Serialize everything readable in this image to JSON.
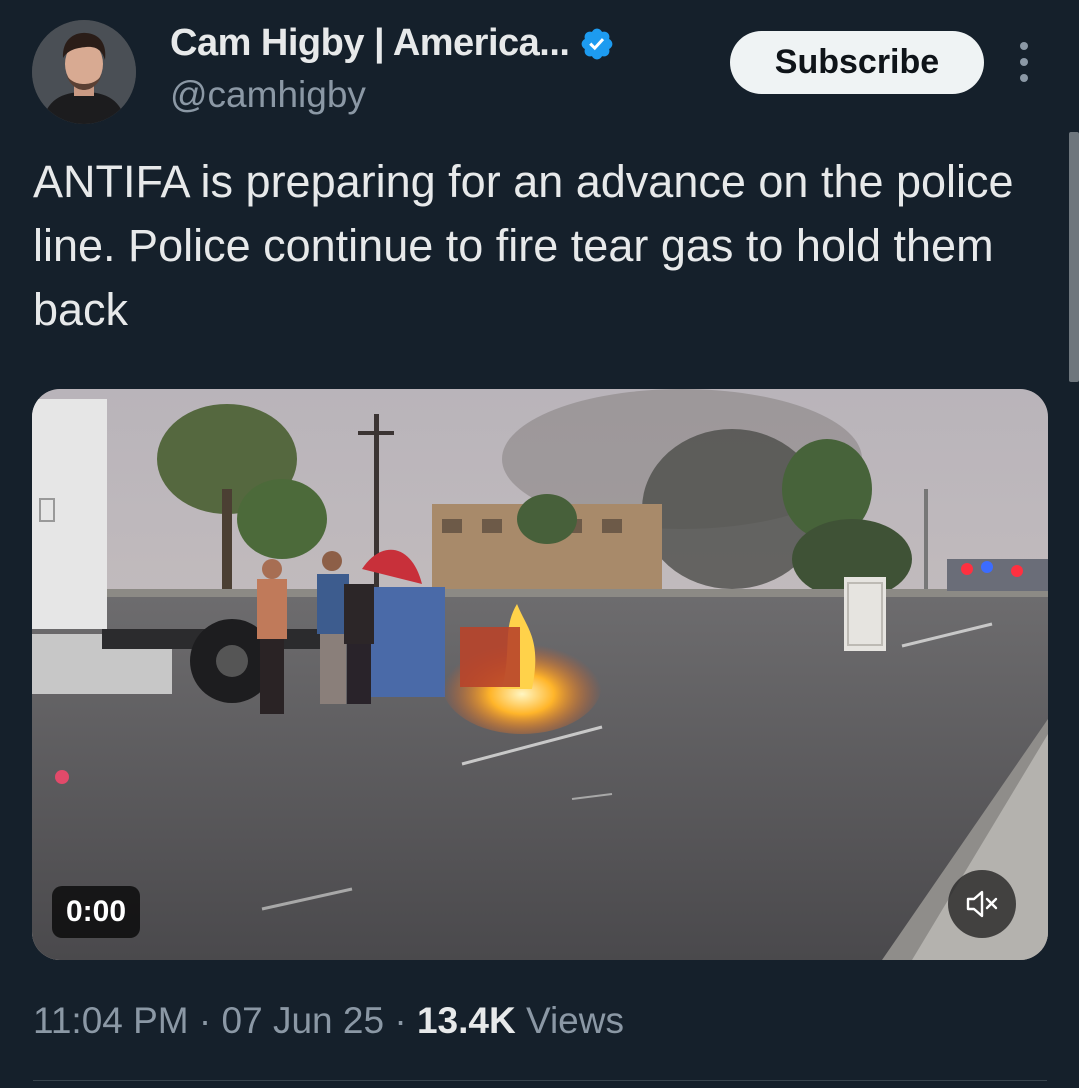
{
  "author": {
    "display_name": "Cam Higby | America...",
    "handle": "@camhigby",
    "verified": true,
    "avatar_icon": "profile-photo"
  },
  "actions": {
    "subscribe_label": "Subscribe",
    "more_icon": "more-vertical-icon"
  },
  "tweet": {
    "text": "ANTIFA is preparing for an advance on the police line. Police continue to fire tear gas to hold them back"
  },
  "video": {
    "duration": "0:00",
    "muted": true,
    "mute_icon": "speaker-muted-icon"
  },
  "meta": {
    "time": "11:04 PM",
    "sep1": " · ",
    "date": "07 Jun 25",
    "sep2": " · ",
    "views_count": "13.4K",
    "views_label": " Views"
  },
  "colors": {
    "background": "#15202b",
    "text": "#e7e9ea",
    "secondary_text": "#8b98a5",
    "verified_blue": "#1d9bf0",
    "button_bg": "#eff3f4"
  }
}
